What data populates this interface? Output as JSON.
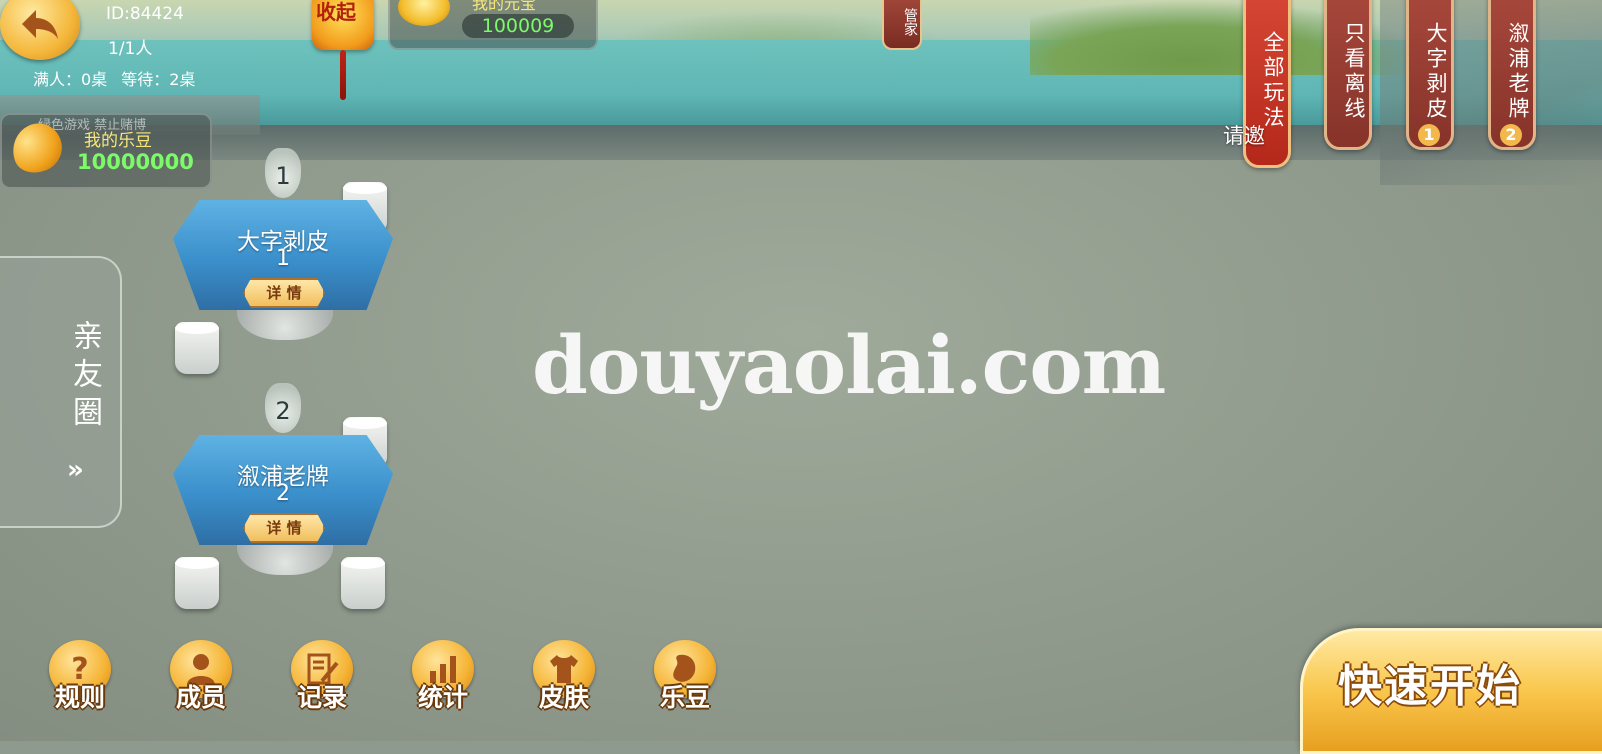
{
  "club": {
    "id": "ID:84424",
    "member_count": "1/1人",
    "full_tables": "满人：0桌",
    "waiting_tables": "等待：2桌",
    "notice": "绿色游戏 禁止赌博"
  },
  "beans": {
    "label": "我的乐豆",
    "value": "10000000"
  },
  "coins": {
    "label": "我的元宝",
    "value": "100009"
  },
  "lantern": {
    "label": "收起"
  },
  "butler": {
    "label": "管家"
  },
  "filters": [
    {
      "label": "全部玩法",
      "count": ""
    },
    {
      "label": "只看离线",
      "count": ""
    },
    {
      "label": "大字剥皮",
      "count": "1"
    },
    {
      "label": "溆浦老牌",
      "count": "2"
    }
  ],
  "invite_label": "请邀",
  "friends_circle": {
    "label": "亲友圈",
    "arrow": "»"
  },
  "tables": [
    {
      "number": "1",
      "game": "大字剥皮",
      "table_no": "1",
      "detail": "详 情"
    },
    {
      "number": "2",
      "game": "溆浦老牌",
      "table_no": "2",
      "detail": "详 情"
    }
  ],
  "watermark": "douyaolai.com",
  "toolbar": [
    {
      "label": "规则",
      "icon": "question-icon"
    },
    {
      "label": "成员",
      "icon": "person-icon"
    },
    {
      "label": "记录",
      "icon": "edit-icon"
    },
    {
      "label": "统计",
      "icon": "bar-chart-icon"
    },
    {
      "label": "皮肤",
      "icon": "shirt-icon"
    },
    {
      "label": "乐豆",
      "icon": "bean-icon"
    }
  ],
  "quick_start": "快速开始",
  "colors": {
    "accent": "#f5b435",
    "banner_red": "#b4281b",
    "table_blue": "#3a8fcb",
    "value_green": "#7dfa6a"
  }
}
